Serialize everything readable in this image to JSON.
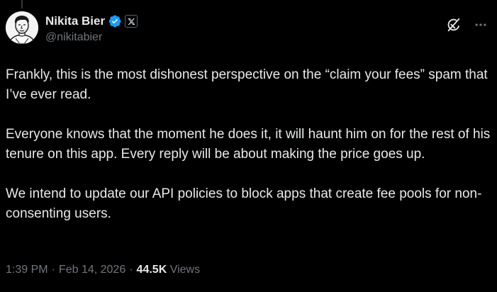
{
  "author": {
    "display_name": "Nikita Bier",
    "handle": "@nikitabier",
    "verified": true,
    "affiliation_badge": "x-logo-icon",
    "avatar_icon": "avatar-illustration"
  },
  "post": {
    "paragraphs": [
      "Frankly, this is the most dishonest perspective on the “claim your fees” spam that I’ve ever read.",
      "Everyone knows that the moment he does it, it will haunt him on for the rest of his tenure on this app. Every reply will be about making the price goes up.",
      "We intend to update our API policies to block apps that create fee pools for non-consenting users."
    ],
    "time": "1:39 PM",
    "date": "Feb 14, 2026",
    "separator": "·",
    "views_count": "44.5K",
    "views_label": "Views"
  },
  "actions": {
    "grok_icon": "grok-icon",
    "more_icon": "more-dots-icon"
  },
  "colors": {
    "background": "#000000",
    "text_primary": "#e7e9ea",
    "text_secondary": "#71767b",
    "verified_blue": "#1d9bf0"
  }
}
